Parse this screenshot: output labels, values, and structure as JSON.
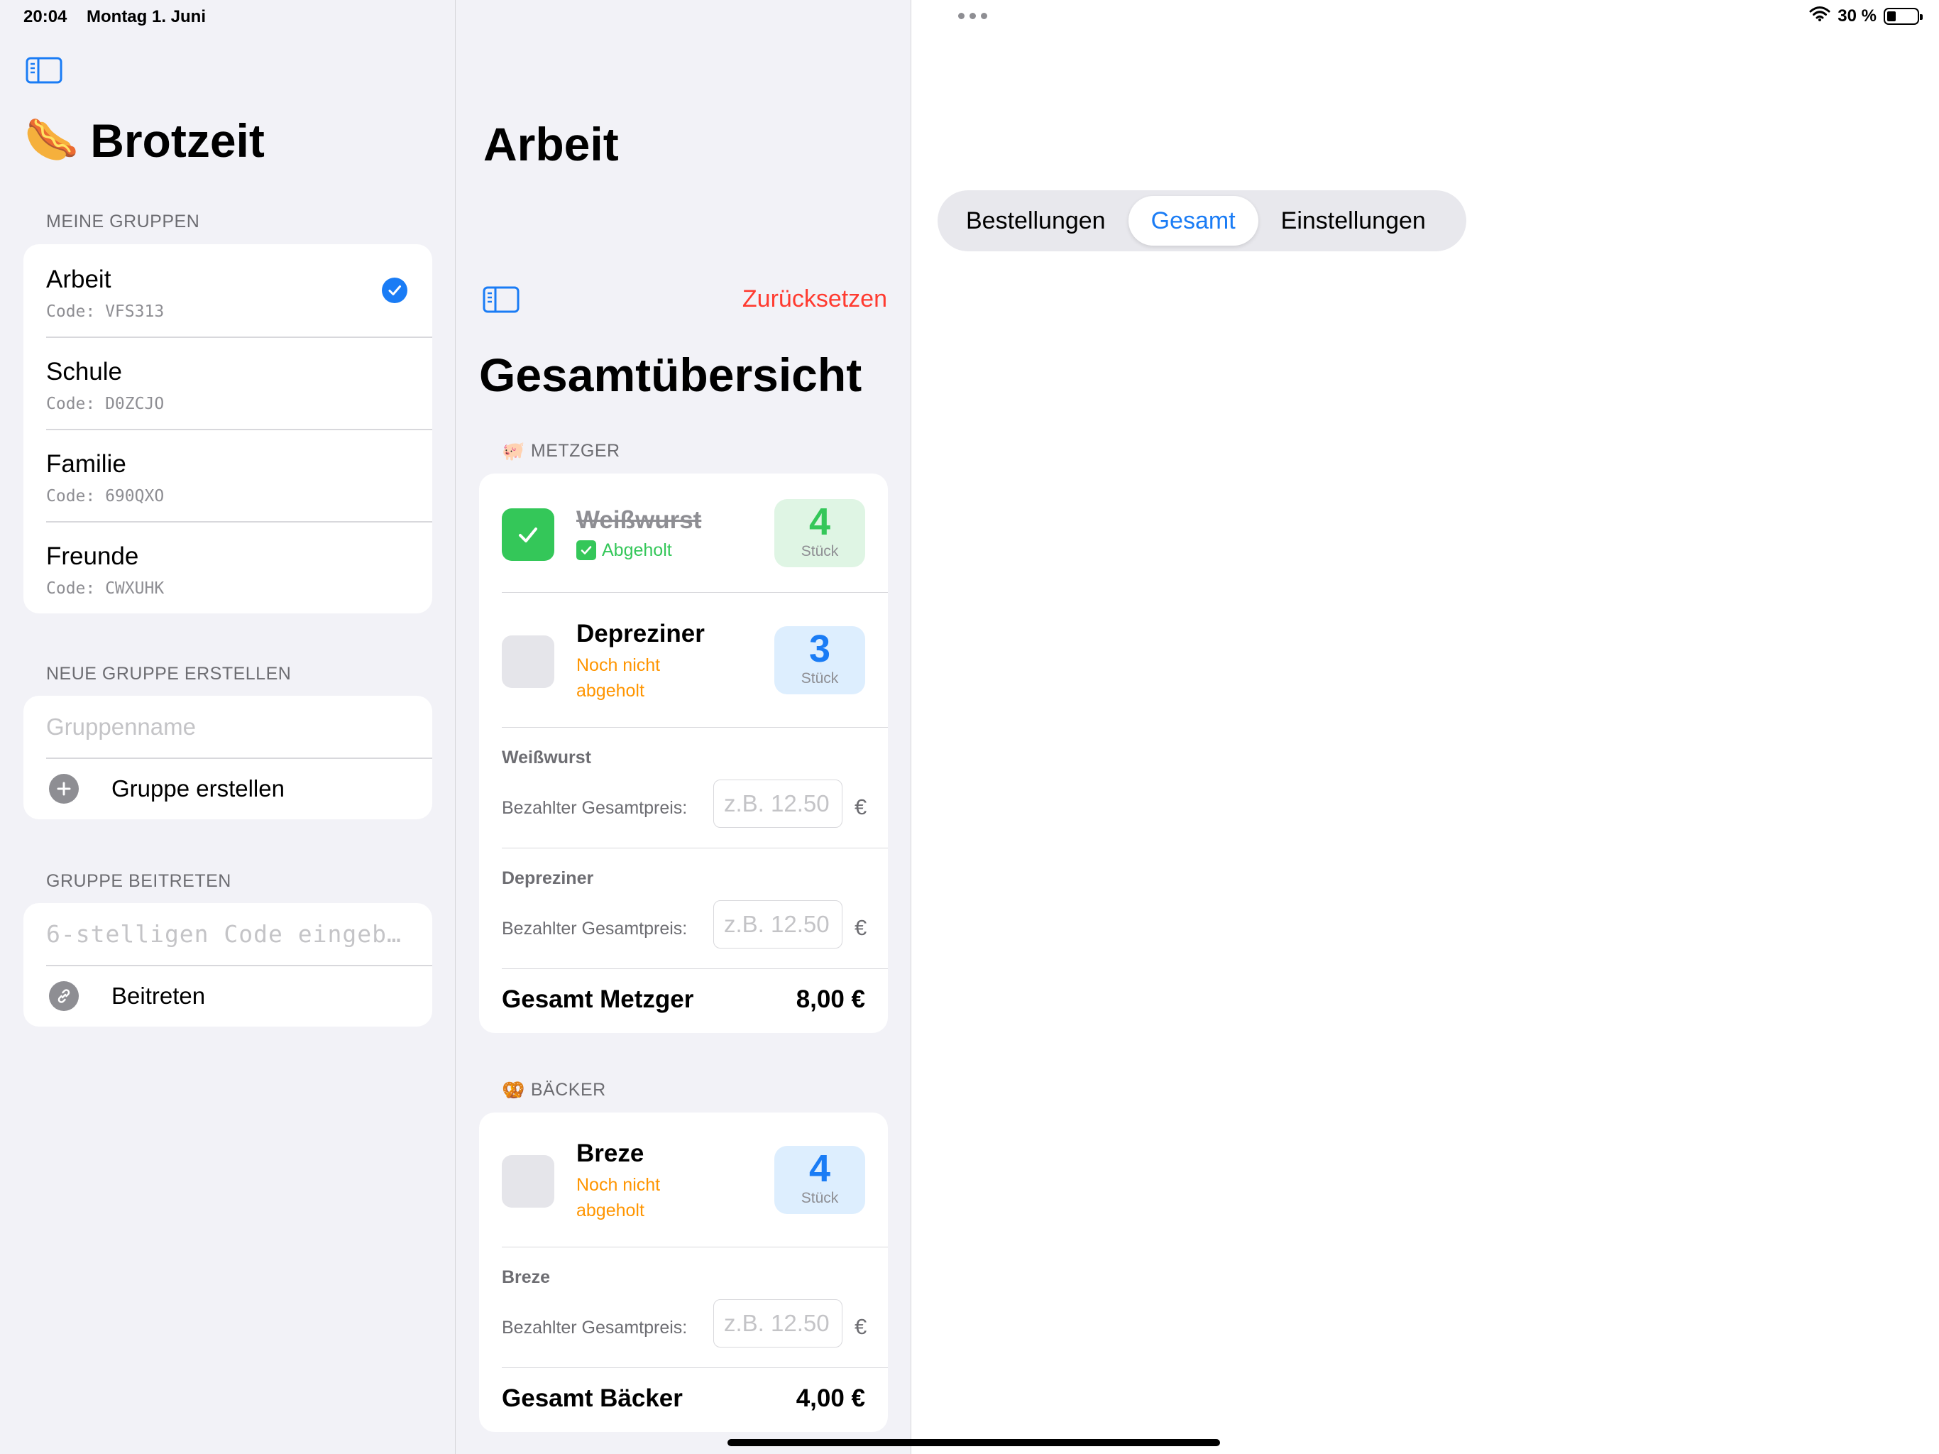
{
  "status_bar": {
    "time": "20:04",
    "date": "Montag 1. Juni",
    "battery_text": "30 %",
    "battery_level": 0.3
  },
  "sidebar": {
    "app_title": "Brotzeit",
    "app_emoji": "🌭",
    "my_groups_header": "MEINE GRUPPEN",
    "groups": [
      {
        "name": "Arbeit",
        "code": "Code: VFS313",
        "selected": true
      },
      {
        "name": "Schule",
        "code": "Code: D0ZCJO",
        "selected": false
      },
      {
        "name": "Familie",
        "code": "Code: 690QXO",
        "selected": false
      },
      {
        "name": "Freunde",
        "code": "Code: CWXUHK",
        "selected": false
      }
    ],
    "create_header": "NEUE GRUPPE ERSTELLEN",
    "create_placeholder": "Gruppenname",
    "create_button": "Gruppe erstellen",
    "join_header": "GRUPPE BEITRETEN",
    "join_placeholder": "6-stelligen Code eingeb…",
    "join_button": "Beitreten"
  },
  "overview": {
    "group_title": "Arbeit",
    "reset_button": "Zurücksetzen",
    "title": "Gesamtübersicht",
    "shops": [
      {
        "emoji": "🐖",
        "header": "METZGER",
        "orders": [
          {
            "name": "Weißwurst",
            "status": "Abgeholt",
            "picked_up": true,
            "quantity": "4",
            "unit": "Stück"
          },
          {
            "name": "Depreziner",
            "status": "Noch nicht abgeholt",
            "picked_up": false,
            "quantity": "3",
            "unit": "Stück"
          }
        ],
        "prices": [
          {
            "item": "Weißwurst",
            "label": "Bezahlter Gesamtpreis:",
            "placeholder": "z.B. 12.50",
            "currency": "€"
          },
          {
            "item": "Depreziner",
            "label": "Bezahlter Gesamtpreis:",
            "placeholder": "z.B. 12.50",
            "currency": "€"
          }
        ],
        "total_label": "Gesamt Metzger",
        "total_value": "8,00 €"
      },
      {
        "emoji": "🥨",
        "header": "BÄCKER",
        "orders": [
          {
            "name": "Breze",
            "status": "Noch nicht abgeholt",
            "picked_up": false,
            "quantity": "4",
            "unit": "Stück"
          }
        ],
        "prices": [
          {
            "item": "Breze",
            "label": "Bezahlter Gesamtpreis:",
            "placeholder": "z.B. 12.50",
            "currency": "€"
          }
        ],
        "total_label": "Gesamt Bäcker",
        "total_value": "4,00 €"
      }
    ]
  },
  "detail": {
    "tabs": [
      "Bestellungen",
      "Gesamt",
      "Einstellungen"
    ],
    "active_tab": "Gesamt"
  },
  "colors": {
    "accent": "#1a7cf5",
    "destructive": "#ff3b30",
    "success": "#34c759",
    "warning": "#ff9500",
    "grouped_background": "#f2f2f7"
  }
}
